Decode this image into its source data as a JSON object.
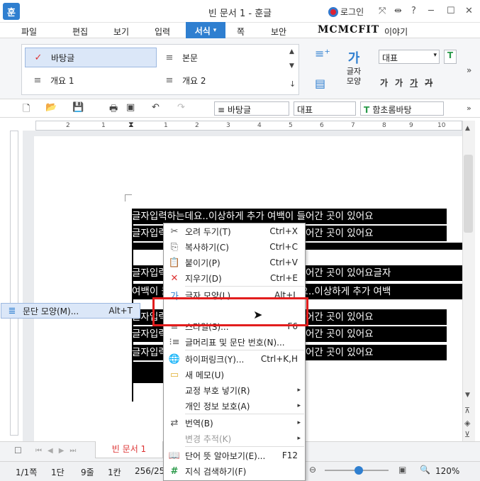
{
  "app": {
    "icon_glyph": "훈",
    "title": "빈 문서 1 - 훈글",
    "login_label": "로그인"
  },
  "menu": [
    "파일",
    "편집",
    "보기",
    "입력",
    "서식",
    "쪽",
    "보안",
    "이야기"
  ],
  "menu_active_index": 4,
  "watermark": "MCMCFIT",
  "ribbon": {
    "styles": [
      "바탕글",
      "본문",
      "개요 1",
      "개요 2"
    ],
    "char_shape_label": "글자\n모양",
    "char_shape_glyph": "가",
    "font_combo": "대표",
    "font_size_glyphs": [
      "가",
      "가",
      "가",
      "가"
    ]
  },
  "toolbar2": {
    "style_combo": "바탕글",
    "lang_combo": "대표",
    "font_combo": "함초롬바탕"
  },
  "ruler_ticks": [
    "2",
    "1",
    "1",
    "2",
    "3",
    "4",
    "5",
    "6",
    "7",
    "8",
    "9",
    "10"
  ],
  "document": {
    "lines": [
      "글자입력하는데요..이상하게 추가 여백이 들어간 곳이 있어요",
      "글자입력하는데요..이상하게 추가 여백이 들어간 곳이 있어요",
      "",
      "글자입력하는데요..이상하게 추가 여백이 들어간 곳이 있어요글자",
      "여백이 들어간 곳이 있어요글자입력하는데요..이상하게 추가 여백",
      "글자입력하는데요..이상하게 추가 여백이 들어간 곳이 있어요",
      "글자입력하는데요..이상하게 추가 여백이 들어간 곳이 있어요",
      "글자입력하는데요..이상하게 추가 여백이 들어간 곳이 있어요"
    ]
  },
  "context_menu": {
    "items": [
      {
        "label": "오려 두기(T)",
        "shortcut": "Ctrl+X",
        "icon": "scissors-icon"
      },
      {
        "label": "복사하기(C)",
        "shortcut": "Ctrl+C",
        "icon": "copy-icon"
      },
      {
        "label": "붙이기(P)",
        "shortcut": "Ctrl+V",
        "icon": "paste-icon"
      },
      {
        "label": "지우기(D)",
        "shortcut": "Ctrl+E",
        "icon": "delete-icon"
      },
      {
        "label": "글자 모양(L)...",
        "shortcut": "Alt+L",
        "icon": "char-shape-icon"
      },
      {
        "label": "문단 모양(M)...",
        "shortcut": "Alt+T",
        "icon": "paragraph-shape-icon"
      },
      {
        "label": "스타일(S)...",
        "shortcut": "F6",
        "icon": "style-icon"
      },
      {
        "label": "글머리표 및 문단 번호(N)...",
        "shortcut": "",
        "icon": "bullet-list-icon"
      },
      {
        "label": "하이퍼링크(Y)...",
        "shortcut": "Ctrl+K,H",
        "icon": "globe-link-icon"
      },
      {
        "label": "새 메모(U)",
        "shortcut": "",
        "icon": "memo-icon"
      },
      {
        "label": "교정 부호 넣기(R)",
        "shortcut": "",
        "icon": ""
      },
      {
        "label": "개인 정보 보호(A)",
        "shortcut": "",
        "icon": ""
      },
      {
        "label": "번역(B)",
        "shortcut": "",
        "icon": "translate-icon"
      },
      {
        "label": "변경 추적(K)",
        "shortcut": "",
        "icon": ""
      },
      {
        "label": "단어 뜻 알아보기(E)...",
        "shortcut": "F12",
        "icon": "dictionary-icon"
      },
      {
        "label": "지식 검색하기(F)",
        "shortcut": "",
        "icon": "hash-icon"
      }
    ]
  },
  "tabs": {
    "doc_tab": "빈 문서 1"
  },
  "status": {
    "page": "1/1쪽",
    "section": "1단",
    "line": "9줄",
    "col": "1칸",
    "pos": "256/25",
    "zoom": "120%"
  }
}
